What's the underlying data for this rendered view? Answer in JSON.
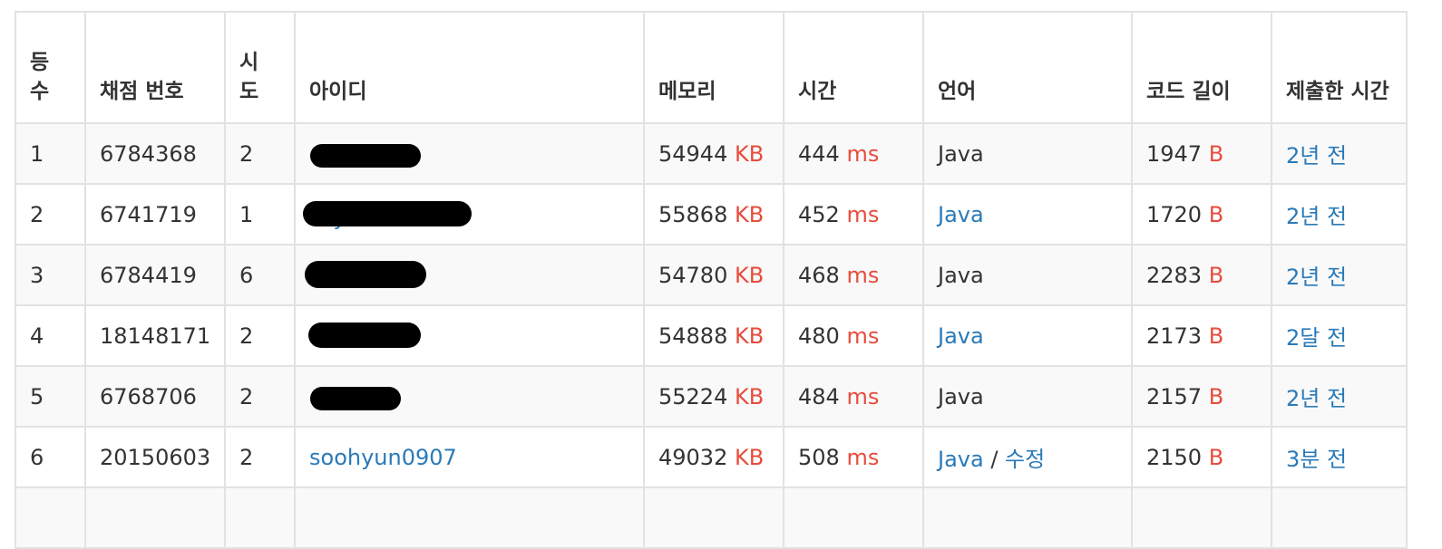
{
  "headers": {
    "rank_line1": "등",
    "rank_line2": "수",
    "submission_no": "채점 번호",
    "tries_line1": "시",
    "tries_line2": "도",
    "user_id": "아이디",
    "memory": "메모리",
    "time": "시간",
    "language": "언어",
    "code_length": "코드 길이",
    "submitted_at": "제출한 시간"
  },
  "units": {
    "memory": "KB",
    "time": "ms",
    "length": "B"
  },
  "rows": [
    {
      "rank": "1",
      "submission": "6784368",
      "tries": "2",
      "user": "",
      "memory": "54944",
      "time": "444",
      "language": "Java",
      "language_link": false,
      "edit": "",
      "length": "1947",
      "when": "2년 전"
    },
    {
      "rank": "2",
      "submission": "6741719",
      "tries": "1",
      "user": "my",
      "memory": "55868",
      "time": "452",
      "language": "Java",
      "language_link": true,
      "edit": "",
      "length": "1720",
      "when": "2년 전"
    },
    {
      "rank": "3",
      "submission": "6784419",
      "tries": "6",
      "user": "",
      "memory": "54780",
      "time": "468",
      "language": "Java",
      "language_link": false,
      "edit": "",
      "length": "2283",
      "when": "2년 전"
    },
    {
      "rank": "4",
      "submission": "18148171",
      "tries": "2",
      "user": "",
      "memory": "54888",
      "time": "480",
      "language": "Java",
      "language_link": true,
      "edit": "",
      "length": "2173",
      "when": "2달 전"
    },
    {
      "rank": "5",
      "submission": "6768706",
      "tries": "2",
      "user": "",
      "memory": "55224",
      "time": "484",
      "language": "Java",
      "language_link": false,
      "edit": "",
      "length": "2157",
      "when": "2년 전"
    },
    {
      "rank": "6",
      "submission": "20150603",
      "tries": "2",
      "user": "soohyun0907",
      "memory": "49032",
      "time": "508",
      "language": "Java",
      "language_link": true,
      "edit": "수정",
      "length": "2150",
      "when": "3분 전"
    }
  ],
  "edit_separator": "/"
}
